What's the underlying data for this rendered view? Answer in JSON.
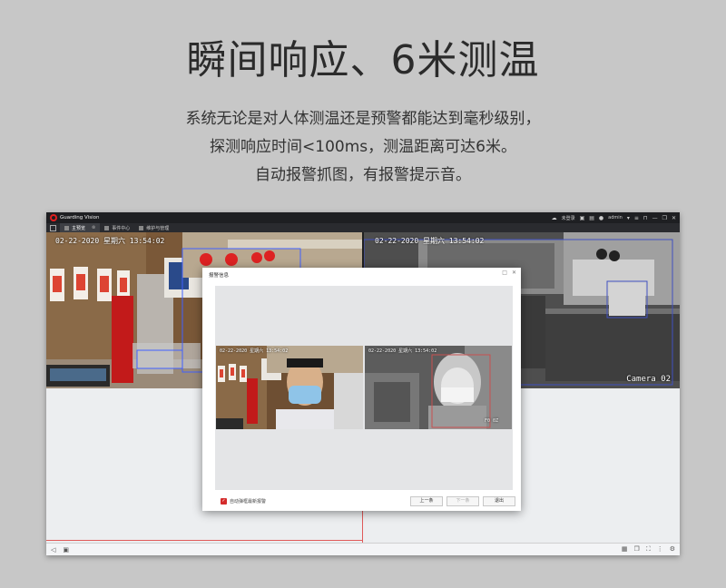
{
  "headline": "瞬间响应、6米测温",
  "description": [
    "系统无论是对人体测温还是预警都能达到毫秒级别，",
    "探测响应时间<100ms，测温距离可达6米。",
    "自动报警抓图，有报警提示音。"
  ],
  "app": {
    "name": "Guarding Vision",
    "titlebar_right": {
      "cloud": "未登录",
      "user": "admin"
    },
    "tabs": [
      {
        "label": "主预览",
        "active": true
      },
      {
        "label": "事件中心",
        "active": false
      },
      {
        "label": "维护与管理",
        "active": false
      }
    ],
    "feeds": {
      "left_osd": "02-22-2020 星期六 13:54:02",
      "right_osd": "02-22-2020 星期六 13:54:02",
      "right_label": "Camera 02"
    }
  },
  "dialog": {
    "title": "报警信息",
    "snap_left_osd": "02-22-2020 星期六 13:54:02",
    "snap_right_osd": "02-22-2020 星期六 13:54:02",
    "snap_right_temp": "F0 0Z",
    "checkbox_label": "自动弹框最新报警",
    "prev_button": "上一条",
    "next_button": "下一条",
    "close_button": "退出"
  },
  "colors": {
    "accent": "#d42b2b",
    "titlebar": "#1e1f22",
    "page_bg": "#c7c7c7"
  }
}
